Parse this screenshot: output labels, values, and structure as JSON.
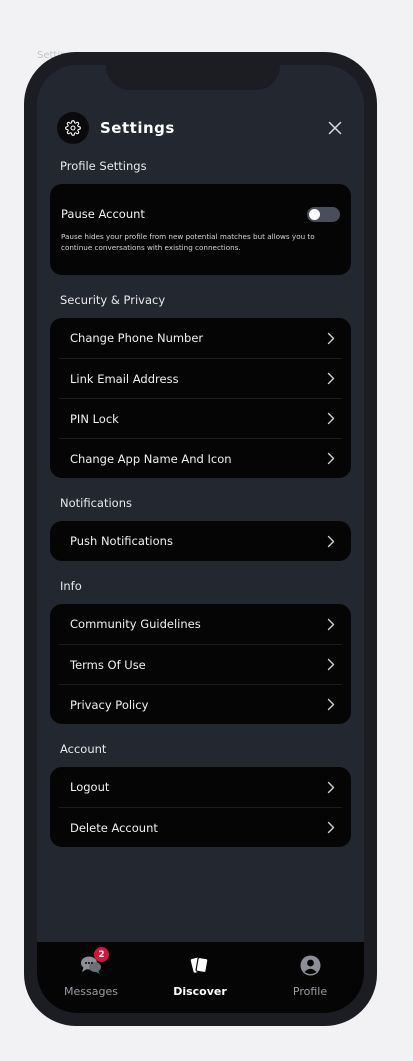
{
  "frame_label": "Settings",
  "header": {
    "title": "Settings"
  },
  "sections": {
    "profile": {
      "title": "Profile Settings",
      "pause_label": "Pause Account",
      "pause_toggle_on": false,
      "pause_description": "Pause hides your profile from new potential matches but allows you to continue conversations with existing connections."
    },
    "security": {
      "title": "Security & Privacy",
      "items": [
        {
          "label": "Change Phone Number"
        },
        {
          "label": "Link Email Address"
        },
        {
          "label": "PIN Lock"
        },
        {
          "label": "Change App Name And Icon"
        }
      ]
    },
    "notifications": {
      "title": "Notifications",
      "items": [
        {
          "label": "Push Notifications"
        }
      ]
    },
    "info": {
      "title": "Info",
      "items": [
        {
          "label": "Community Guidelines"
        },
        {
          "label": "Terms Of Use"
        },
        {
          "label": "Privacy Policy"
        }
      ]
    },
    "account": {
      "title": "Account",
      "items": [
        {
          "label": "Logout"
        },
        {
          "label": "Delete Account"
        }
      ]
    }
  },
  "tabbar": {
    "messages": {
      "label": "Messages",
      "badge": "2",
      "icon": "chat-bubbles-icon"
    },
    "discover": {
      "label": "Discover",
      "icon": "cards-icon",
      "active": true
    },
    "profile": {
      "label": "Profile",
      "icon": "user-circle-icon"
    }
  },
  "colors": {
    "background": "#232730",
    "card": "#050506",
    "badge": "#d4163c",
    "toggle_off": "#4a4e5c"
  }
}
